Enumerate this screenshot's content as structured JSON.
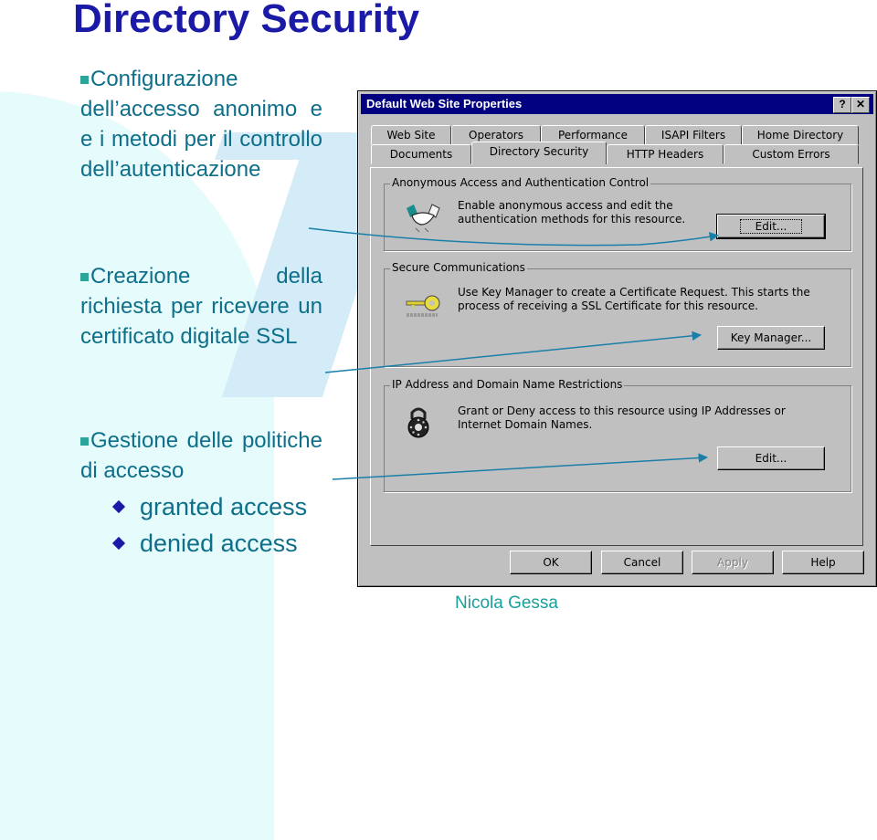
{
  "slide": {
    "title": "Directory Security",
    "author": "Nicola Gessa",
    "bullets": [
      {
        "text": "Configurazione dell’accesso anonimo e e i metodi per il controllo dell’autenticazione"
      },
      {
        "text": "Creazione della richiesta per ricevere un certificato digitale SSL"
      },
      {
        "text": "Gestione delle politiche di accesso"
      }
    ],
    "sub_bullets": [
      "granted access",
      "denied access"
    ],
    "colors": {
      "title": "#1a1aa6",
      "body": "#0e6f8a",
      "bullet": "#2aa59a",
      "arrow": "#1a7fa8"
    }
  },
  "dialog": {
    "title": "Default Web Site Properties",
    "help_label": "?",
    "close_label": "✕",
    "tabs_row1": [
      "Web Site",
      "Operators",
      "Performance",
      "ISAPI Filters",
      "Home Directory"
    ],
    "tabs_row2": [
      "Documents",
      "Directory Security",
      "HTTP Headers",
      "Custom Errors"
    ],
    "active_tab": "Directory Security",
    "groups": [
      {
        "legend": "Anonymous Access and Authentication Control",
        "icon": "handshake-icon",
        "text": "Enable anonymous access and edit the authentication methods for this resource.",
        "button": "Edit..."
      },
      {
        "legend": "Secure Communications",
        "icon": "key-icon",
        "text": "Use Key Manager to create a Certificate Request.  This starts the process of receiving a SSL Certificate for this resource.",
        "button": "Key Manager..."
      },
      {
        "legend": "IP Address and Domain Name Restrictions",
        "icon": "padlock-icon",
        "text": "Grant or Deny access to this resource using IP Addresses or Internet Domain Names.",
        "button": "Edit..."
      }
    ],
    "buttons": {
      "ok": "OK",
      "cancel": "Cancel",
      "apply": "Apply",
      "help": "Help"
    }
  }
}
